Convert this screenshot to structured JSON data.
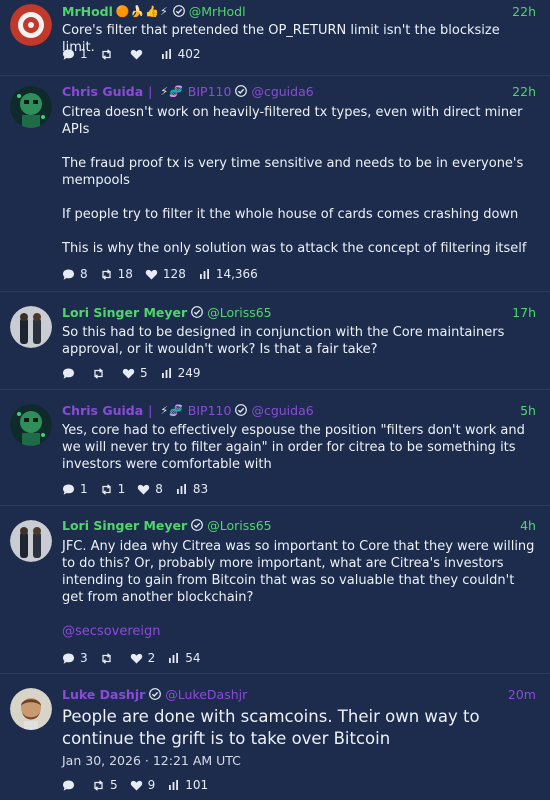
{
  "posts": [
    {
      "name": "MrHodl",
      "badges": "🟠🍌👍⚡",
      "handle": "@MrHodl",
      "time": "22h",
      "text": [
        "Core's filter that pretended the OP_RETURN limit isn't the blocksize limit."
      ],
      "replies": "1",
      "reposts": "",
      "likes": "",
      "views": "402"
    },
    {
      "name": "Chris Guida",
      "badges": "⚡🧬",
      "tag": "BIP110",
      "handle": "@cguida6",
      "time": "22h",
      "text": [
        "Citrea doesn't work on heavily-filtered tx types, even with direct miner APIs",
        "The fraud proof tx is very time sensitive and needs to be in everyone's mempools",
        "If people try to filter it the whole house of cards comes crashing down",
        "This is why the only solution was to attack the concept of filtering itself"
      ],
      "replies": "8",
      "reposts": "18",
      "likes": "128",
      "views": "14,366"
    },
    {
      "name": "Lori Singer Meyer",
      "handle": "@Loriss65",
      "time": "17h",
      "text": [
        "So this had to be designed in conjunction with the Core maintainers approval, or it wouldn't work?  Is that a fair take?"
      ],
      "replies": "",
      "reposts": "",
      "likes": "5",
      "views": "249"
    },
    {
      "name": "Chris Guida",
      "badges": "⚡🧬",
      "tag": "BIP110",
      "handle": "@cguida6",
      "time": "5h",
      "text": [
        "Yes, core had to effectively espouse the position \"filters don't work and we will never try to filter again\" in order for citrea to be something its investors were comfortable with"
      ],
      "replies": "1",
      "reposts": "1",
      "likes": "8",
      "views": "83"
    },
    {
      "name": "Lori Singer Meyer",
      "handle": "@Loriss65",
      "time": "4h",
      "text": [
        "JFC.  Any idea why Citrea was so important to Core that they were willing to do this? Or, probably more important, what are Citrea's investors intending to gain from Bitcoin that was so valuable that they couldn't get from another blockchain?"
      ],
      "mention": "@secsovereign",
      "replies": "3",
      "reposts": "",
      "likes": "2",
      "views": "54"
    },
    {
      "name": "Luke Dashjr",
      "handle": "@LukeDashjr",
      "time": "20m",
      "text": [
        "People are done with scamcoins. Their own way to continue the grift is to take over Bitcoin"
      ],
      "date": "Jan 30, 2026 · 12:21 AM UTC",
      "replies": "",
      "reposts": "5",
      "likes": "9",
      "views": "101"
    }
  ],
  "icons": {
    "reply": "speech-bubble-icon",
    "repost": "retweet-arrows-icon",
    "like": "heart-icon",
    "views": "bar-chart-icon",
    "verified": "verified-check-icon"
  },
  "colors": {
    "background": "#1d2c4c",
    "green": "#4fd66a",
    "purple": "#8a4bd8",
    "text": "#eef1f8"
  }
}
